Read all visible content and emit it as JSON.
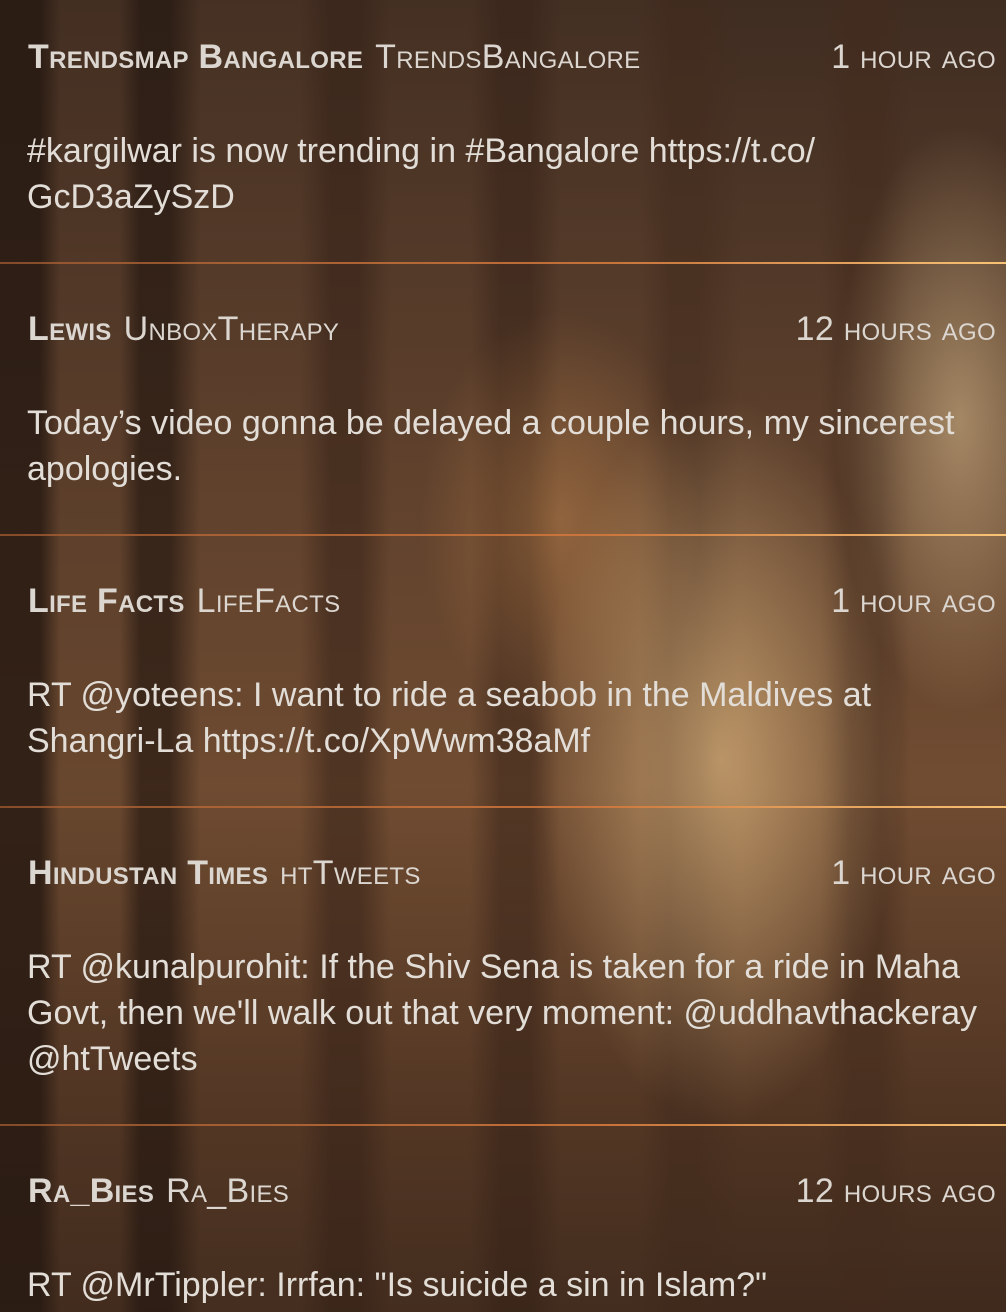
{
  "tweets": [
    {
      "display_name": "Trendsmap Bangalore",
      "handle": "TrendsBangalore",
      "time": "1 hour ago",
      "text": "#kargilwar is now trending in #Bangalore https://t.co/ GcD3aZySzD"
    },
    {
      "display_name": "Lewis",
      "handle": "UnboxTherapy",
      "time": "12 hours ago",
      "text": "Today’s video gonna be delayed a couple hours, my sincerest apologies."
    },
    {
      "display_name": "Life Facts",
      "handle": "LifeFacts",
      "time": "1 hour ago",
      "text": "RT @yoteens: I want to ride a seabob in the Maldives at Shangri-La https://t.co/XpWwm38aMf"
    },
    {
      "display_name": "Hindustan Times",
      "handle": "htTweets",
      "time": "1 hour ago",
      "text": "RT @kunalpurohit: If the Shiv Sena is taken for a ride in Maha Govt, then we'll walk out that very moment: @uddhavthackeray @htTweets"
    },
    {
      "display_name": "Ra_Bies",
      "handle": "Ra_Bies",
      "time": "12 hours ago",
      "text": "RT @MrTippler: Irrfan: \"Is suicide a sin in Islam?\""
    }
  ]
}
